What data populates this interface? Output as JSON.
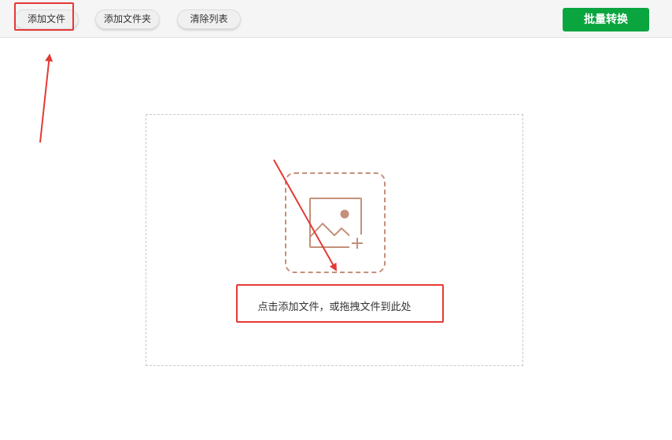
{
  "toolbar": {
    "add_file": "添加文件",
    "add_folder": "添加文件夹",
    "clear_list": "清除列表",
    "batch_convert": "批量转换"
  },
  "drop_zone": {
    "hint": "点击添加文件，或拖拽文件到此处",
    "icon": "image-add-icon"
  },
  "colors": {
    "accent_green": "#0aa53f",
    "icon_brown": "#c4907a",
    "annotation_red": "#e53935"
  }
}
